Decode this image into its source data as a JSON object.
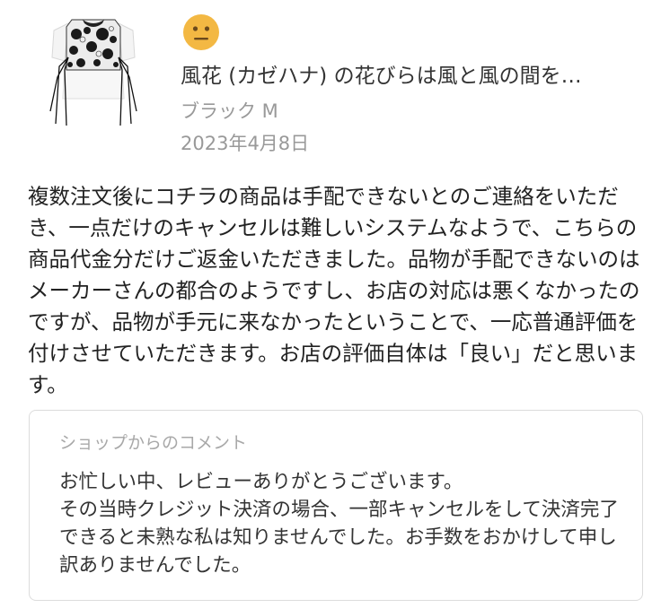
{
  "review": {
    "product_image_icon": "sheer-floral-blouse-icon",
    "rating_icon": "neutral-face-icon",
    "rating_color": "#f3b843",
    "product_title": "風花 (カゼハナ) の花びらは風と風の間を…",
    "variant": "ブラック M",
    "date": "2023年4月8日",
    "body": "複数注文後にコチラの商品は手配できないとのご連絡をいただき、一点だけのキャンセルは難しいシステムなようで、こちらの商品代金分だけご返金いただきました。品物が手配できないのはメーカーさんの都合のようですし、お店の対応は悪くなかったのですが、品物が手元に来なかったということで、一応普通評価を付けさせていただきます。お店の評価自体は「良い」だと思います。"
  },
  "shop_comment": {
    "label": "ショップからのコメント",
    "paragraphs": [
      "お忙しい中、レビューありがとうございます。",
      "その当時クレジット決済の場合、一部キャンセルをして決済完了できると未熟な私は知りませんでした。お手数をおかけして申し訳ありませんでした。"
    ]
  }
}
